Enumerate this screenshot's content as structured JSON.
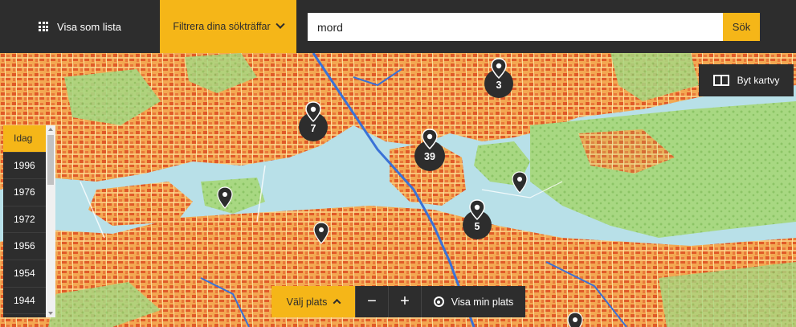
{
  "header": {
    "list_view_label": "Visa som lista",
    "filter_label": "Filtrera dina sökträffar",
    "search_value": "mord",
    "search_button_label": "Sök"
  },
  "map_controls": {
    "change_map_label": "Byt kartvy",
    "choose_place_label": "Välj plats",
    "zoom_out_label": "−",
    "zoom_in_label": "+",
    "my_location_label": "Visa min plats"
  },
  "timeline": {
    "years": [
      "Idag",
      "1996",
      "1976",
      "1972",
      "1956",
      "1954",
      "1944"
    ],
    "selected": "Idag"
  },
  "markers": {
    "clusters": [
      "3",
      "7",
      "39",
      "5"
    ],
    "single_count": 5
  },
  "colors": {
    "accent": "#f5b618",
    "dark": "#2d2d2d",
    "water": "#b8e0e8",
    "urban": "#f0a050",
    "building": "#e05a28",
    "park": "#9ed07a"
  }
}
